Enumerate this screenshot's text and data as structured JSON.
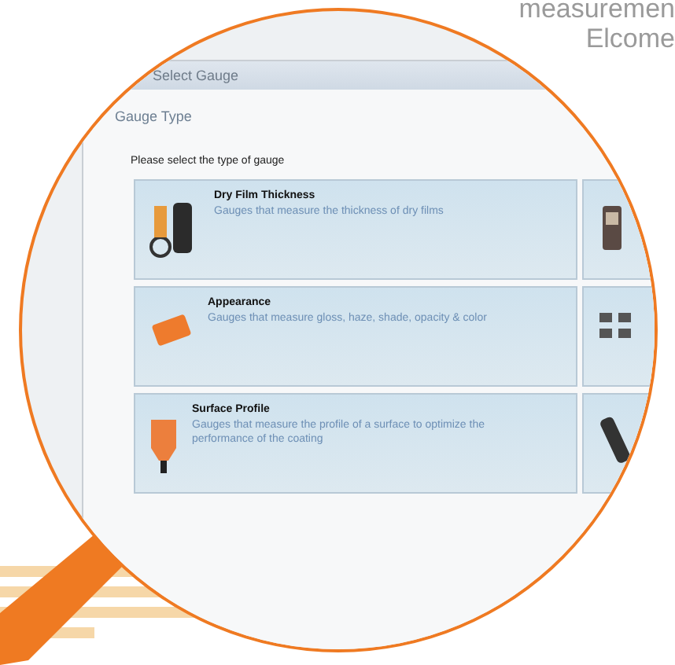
{
  "caption": {
    "lines": [
      "measuremen",
      "Elcome"
    ]
  },
  "window": {
    "title": "Select Gauge",
    "heading": "Gauge Type",
    "prompt": "Please select the type of gauge"
  },
  "cards": [
    {
      "title": "Dry Film Thickness",
      "description": "Gauges that measure the thickness of dry films",
      "kind": "probe"
    },
    {
      "kind": "handheld"
    },
    {
      "title": "Appearance",
      "description": "Gauges that measure gloss, haze, shade, opacity & color",
      "kind": "panel"
    },
    {
      "kind": "pair"
    },
    {
      "title": "Surface Profile",
      "description": "Gauges that measure the profile of a surface to optimize the performance of the coating",
      "kind": "bulb"
    },
    {
      "kind": "stick"
    }
  ]
}
